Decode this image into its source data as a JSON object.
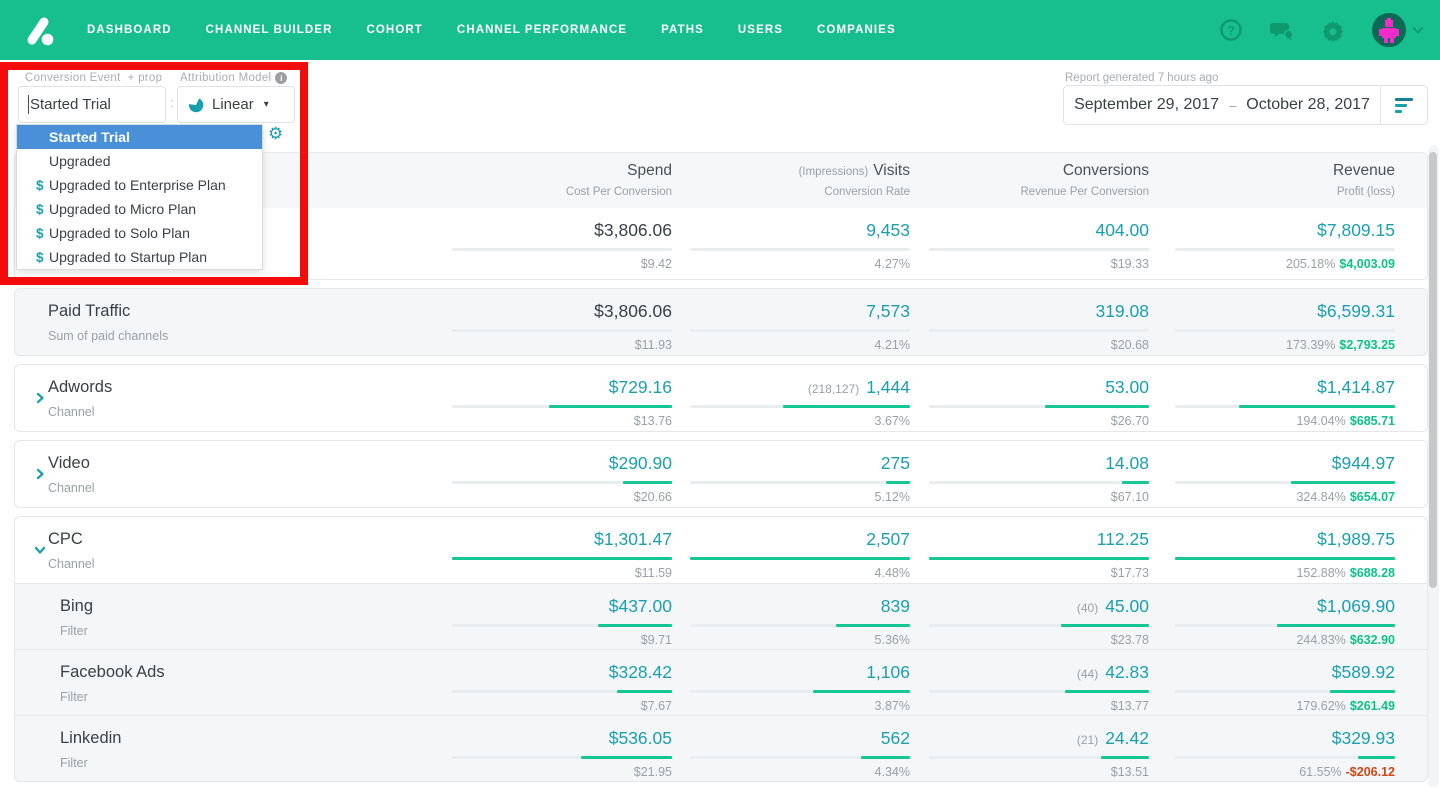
{
  "nav": {
    "logo": "attribution-logo",
    "items": [
      "DASHBOARD",
      "CHANNEL BUILDER",
      "COHORT",
      "CHANNEL PERFORMANCE",
      "PATHS",
      "USERS",
      "COMPANIES"
    ],
    "icons": [
      "help-icon",
      "chat-icon",
      "settings-icon",
      "avatar",
      "caret-down-icon"
    ]
  },
  "controls": {
    "conversion_event": {
      "label": "Conversion Event",
      "add_prop": "+ prop",
      "value": "Started Trial"
    },
    "separator": ":",
    "attribution_model": {
      "label": "Attribution Model",
      "value": "Linear",
      "icon": "pie-chart-icon",
      "caret": "▾"
    },
    "dropdown": {
      "items": [
        {
          "label": "Started Trial",
          "money": false,
          "selected": true
        },
        {
          "label": "Upgraded",
          "money": false,
          "selected": false
        },
        {
          "label": "Upgraded to Enterprise Plan",
          "money": true,
          "selected": false
        },
        {
          "label": "Upgraded to Micro Plan",
          "money": true,
          "selected": false
        },
        {
          "label": "Upgraded to Solo Plan",
          "money": true,
          "selected": false
        },
        {
          "label": "Upgraded to Startup Plan",
          "money": true,
          "selected": false
        }
      ],
      "money_glyph": "$"
    }
  },
  "report": {
    "generated": "Report generated 7 hours ago",
    "date_start": "September 29, 2017",
    "date_separator": "–",
    "date_end": "October 28, 2017"
  },
  "table": {
    "columns": [
      {
        "label": "Spend",
        "sub": "Cost Per Conversion",
        "prefix": ""
      },
      {
        "label": "Visits",
        "sub": "Conversion Rate",
        "prefix": "(Impressions)"
      },
      {
        "label": "Conversions",
        "sub": "Revenue Per Conversion",
        "prefix": ""
      },
      {
        "label": "Revenue",
        "sub": "Profit (loss)",
        "prefix": ""
      }
    ],
    "rows": [
      {
        "name": "",
        "subtitle": "",
        "kind": "total",
        "chevron": "none",
        "cells": [
          {
            "main": "$3,806.06",
            "sub": "$9.42"
          },
          {
            "main": "9,453",
            "sub": "4.27%"
          },
          {
            "main": "404.00",
            "sub": "$19.33"
          },
          {
            "main": "$7,809.15",
            "sub": "205.18%",
            "profit": "$4,003.09",
            "profit_sign": "pos"
          }
        ]
      },
      {
        "name": "Paid Traffic",
        "subtitle": "Sum of paid channels",
        "kind": "summary",
        "chevron": "none",
        "cells": [
          {
            "main": "$3,806.06",
            "sub": "$11.93"
          },
          {
            "main": "7,573",
            "sub": "4.21%"
          },
          {
            "main": "319.08",
            "sub": "$20.68"
          },
          {
            "main": "$6,599.31",
            "sub": "173.39%",
            "profit": "$2,793.25",
            "profit_sign": "pos"
          }
        ]
      },
      {
        "name": "Adwords",
        "subtitle": "Channel",
        "kind": "channel",
        "chevron": "collapsed",
        "cells": [
          {
            "main": "$729.16",
            "sub": "$13.76"
          },
          {
            "pre": "(218,127)",
            "main": "1,444",
            "sub": "3.67%"
          },
          {
            "main": "53.00",
            "sub": "$26.70"
          },
          {
            "main": "$1,414.87",
            "sub": "194.04%",
            "profit": "$685.71",
            "profit_sign": "pos"
          }
        ]
      },
      {
        "name": "Video",
        "subtitle": "Channel",
        "kind": "channel",
        "chevron": "collapsed",
        "cells": [
          {
            "main": "$290.90",
            "sub": "$20.66"
          },
          {
            "main": "275",
            "sub": "5.12%"
          },
          {
            "main": "14.08",
            "sub": "$67.10"
          },
          {
            "main": "$944.97",
            "sub": "324.84%",
            "profit": "$654.07",
            "profit_sign": "pos"
          }
        ]
      },
      {
        "name": "CPC",
        "subtitle": "Channel",
        "kind": "channel",
        "chevron": "expanded",
        "cells": [
          {
            "main": "$1,301.47",
            "sub": "$11.59"
          },
          {
            "main": "2,507",
            "sub": "4.48%"
          },
          {
            "main": "112.25",
            "sub": "$17.73"
          },
          {
            "main": "$1,989.75",
            "sub": "152.88%",
            "profit": "$688.28",
            "profit_sign": "pos"
          }
        ]
      },
      {
        "name": "Bing",
        "subtitle": "Filter",
        "kind": "filter",
        "chevron": "none",
        "cells": [
          {
            "main": "$437.00",
            "sub": "$9.71"
          },
          {
            "main": "839",
            "sub": "5.36%"
          },
          {
            "pre": "(40)",
            "main": "45.00",
            "sub": "$23.78"
          },
          {
            "main": "$1,069.90",
            "sub": "244.83%",
            "profit": "$632.90",
            "profit_sign": "pos"
          }
        ]
      },
      {
        "name": "Facebook Ads",
        "subtitle": "Filter",
        "kind": "filter",
        "chevron": "none",
        "cells": [
          {
            "main": "$328.42",
            "sub": "$7.67"
          },
          {
            "main": "1,106",
            "sub": "3.87%"
          },
          {
            "pre": "(44)",
            "main": "42.83",
            "sub": "$13.77"
          },
          {
            "main": "$589.92",
            "sub": "179.62%",
            "profit": "$261.49",
            "profit_sign": "pos"
          }
        ]
      },
      {
        "name": "Linkedin",
        "subtitle": "Filter",
        "kind": "filter",
        "chevron": "none",
        "cells": [
          {
            "main": "$536.05",
            "sub": "$21.95"
          },
          {
            "main": "562",
            "sub": "4.34%"
          },
          {
            "pre": "(21)",
            "main": "24.42",
            "sub": "$13.51"
          },
          {
            "main": "$329.93",
            "sub": "61.55%",
            "profit": "-$206.12",
            "profit_sign": "neg"
          }
        ]
      }
    ]
  },
  "colors": {
    "nav_green": "#17bf8e",
    "teal_accent": "#1a9fb0",
    "bar_green": "#15c794",
    "profit_green": "#0dc288",
    "loss_red": "#cb4714",
    "selected_blue": "#4a90d9",
    "annotation_red": "#f40b0b"
  }
}
